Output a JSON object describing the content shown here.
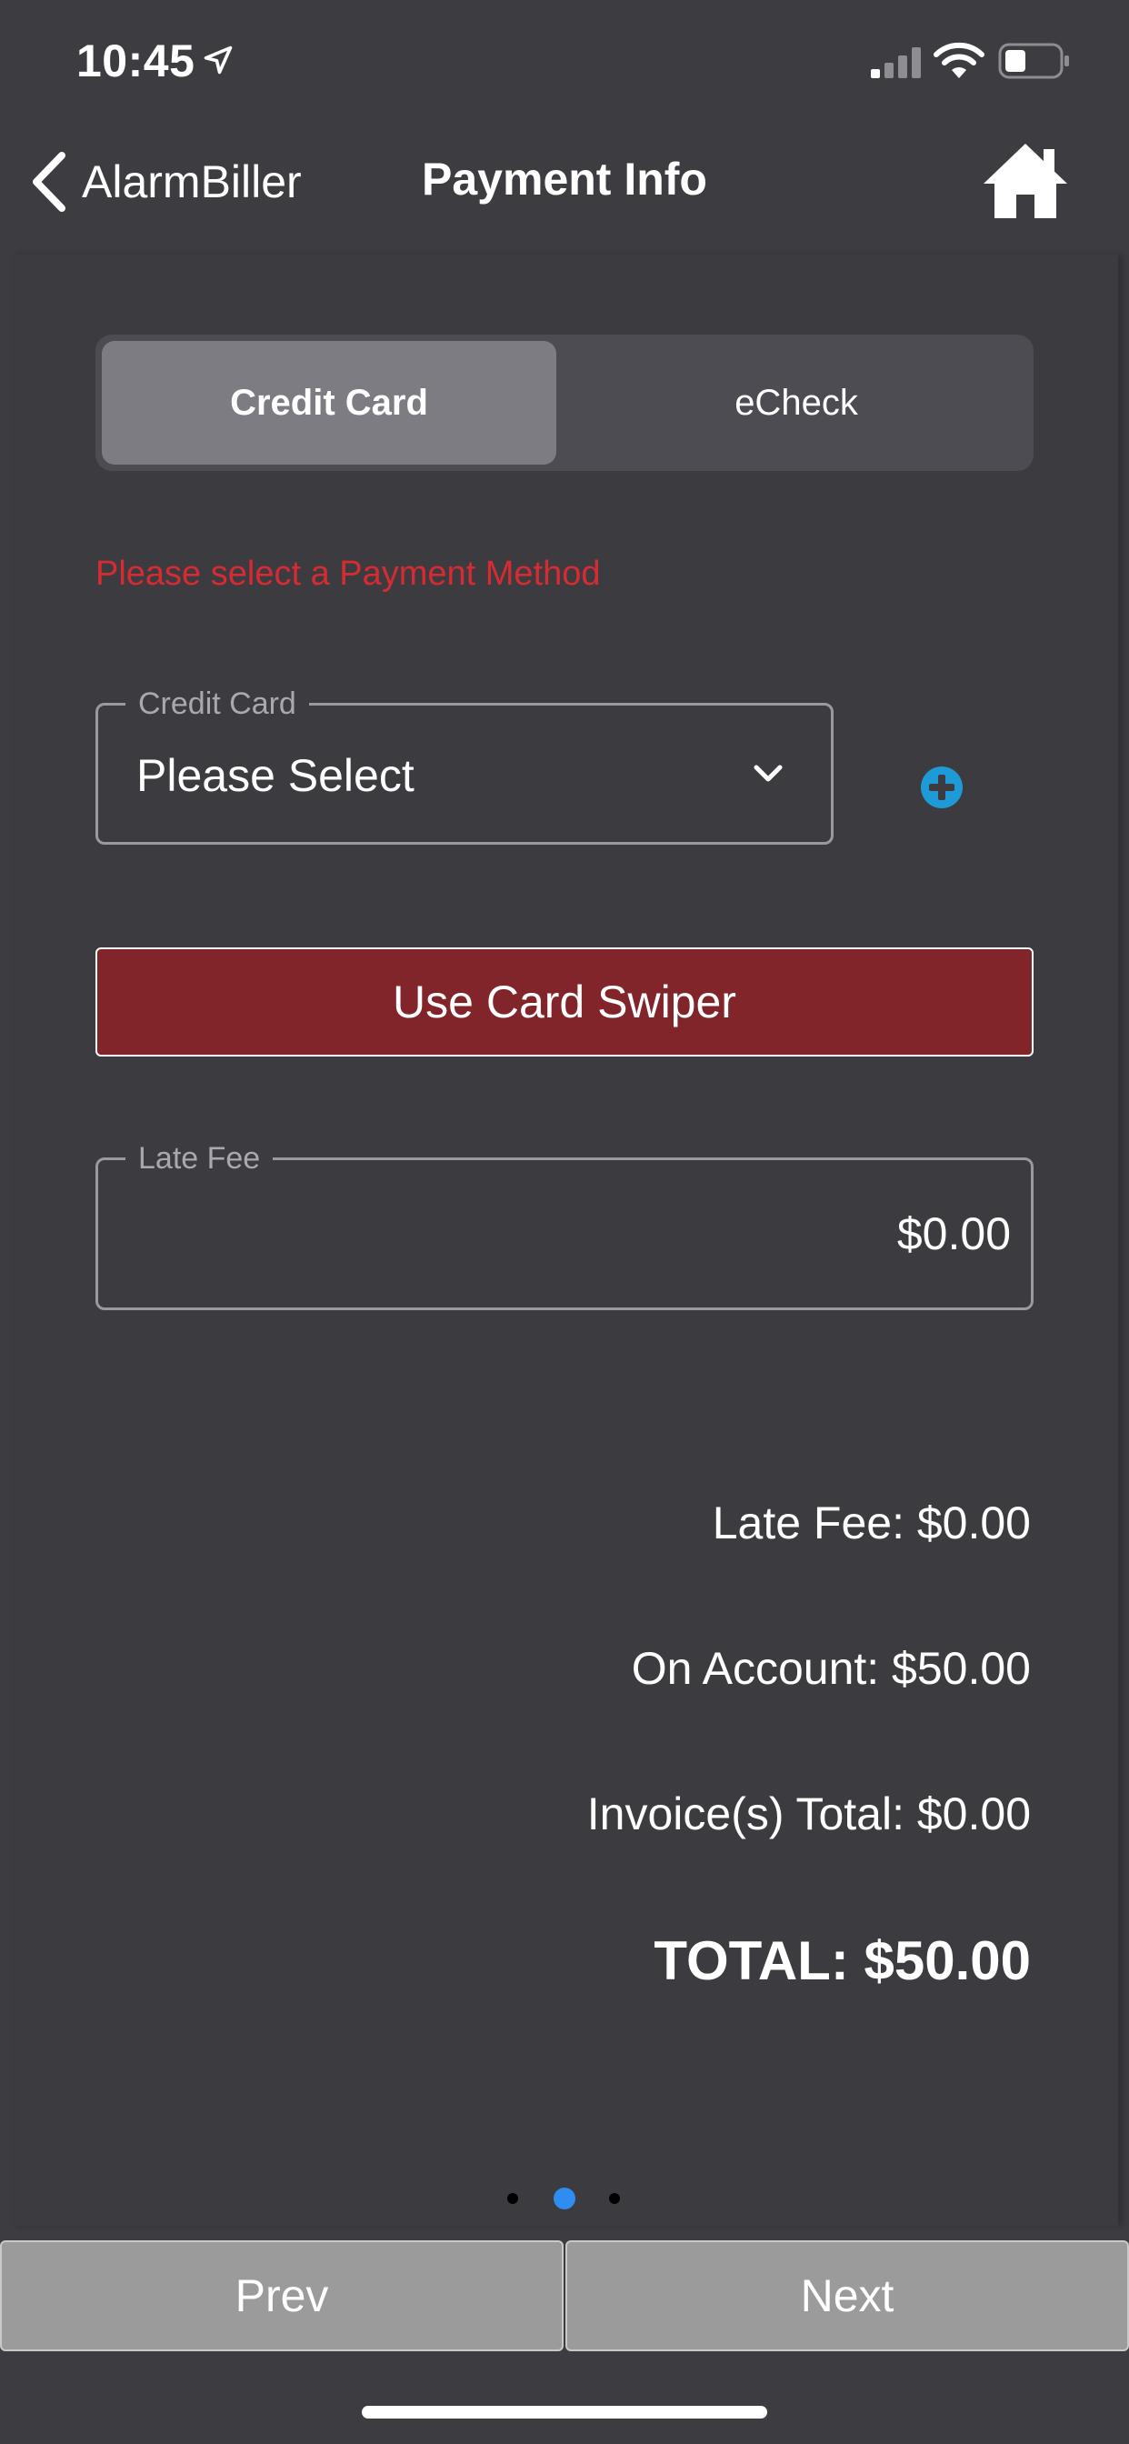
{
  "status_bar": {
    "time": "10:45",
    "icons": [
      "location-arrow-icon",
      "cellular-signal-icon",
      "wifi-icon",
      "battery-icon"
    ]
  },
  "nav": {
    "back_label": "AlarmBiller",
    "title": "Payment Info",
    "home_icon": "home-icon"
  },
  "payment_method": {
    "tabs": [
      {
        "label": "Credit Card",
        "selected": true
      },
      {
        "label": "eCheck",
        "selected": false
      }
    ],
    "error": "Please select a Payment Method"
  },
  "credit_card_field": {
    "label": "Credit Card",
    "value": "Please Select"
  },
  "card_swiper_button": "Use Card Swiper",
  "late_fee_field": {
    "label": "Late Fee",
    "value": "$0.00"
  },
  "summary": {
    "late_fee": "Late Fee: $0.00",
    "on_account": "On Account: $50.00",
    "invoices_total": "Invoice(s) Total: $0.00",
    "total": "TOTAL: $50.00"
  },
  "pager": {
    "pages": 3,
    "current": 2
  },
  "buttons": {
    "prev": "Prev",
    "next": "Next"
  },
  "colors": {
    "background": "#3d3c41",
    "error": "#d62b32",
    "swiper_button": "#82252a",
    "add_icon": "#1e9bd7",
    "active_dot": "#2f8cf0",
    "bottom_buttons": "#9b9b9b"
  }
}
